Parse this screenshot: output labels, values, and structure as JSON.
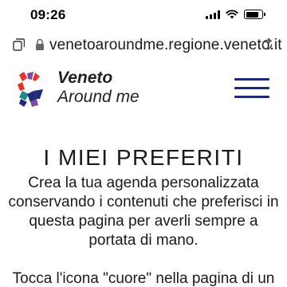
{
  "status": {
    "time": "09:26",
    "icons": [
      "signal-icon",
      "wifi-icon",
      "battery-icon"
    ]
  },
  "browser": {
    "url": "venetoaroundme.regione.veneto.it",
    "icons": [
      "tabs-icon",
      "lock-icon",
      "reload-icon"
    ]
  },
  "header": {
    "logo_line1": "Veneto",
    "logo_line2": "Around me",
    "colors": {
      "logo_red": "#e63329",
      "logo_navy": "#1e2a7a",
      "logo_purple": "#7b4fa0",
      "logo_teal": "#1f8a8a"
    }
  },
  "content": {
    "title": "I MIEI PREFERITI",
    "intro": "Crea la tua agenda personalizzata conservando i contenuti che preferisci in questa pagina per averli sempre a portata di mano.",
    "instruction": "Tocca l'icona \"cuore\" nella pagina di un"
  }
}
